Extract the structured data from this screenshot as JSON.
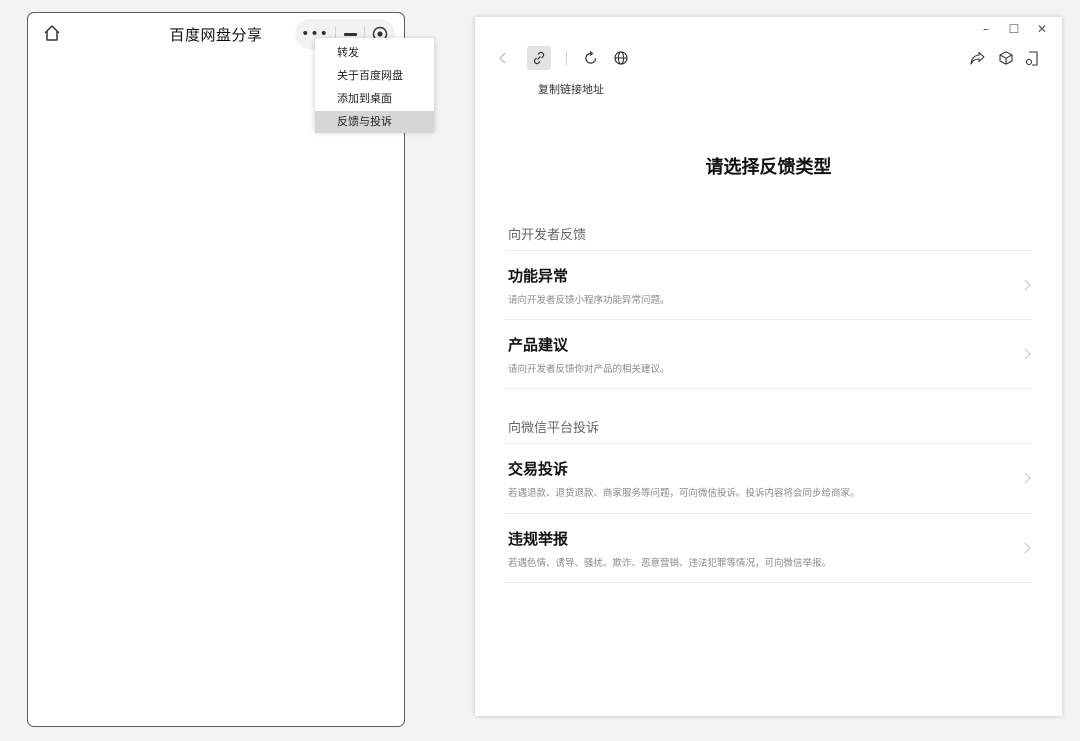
{
  "mini_program": {
    "title": "百度网盘分享",
    "capsule": {
      "more_label": "•••"
    },
    "menu": {
      "items": [
        {
          "label": "转发"
        },
        {
          "label": "关于百度网盘"
        },
        {
          "label": "添加到桌面"
        },
        {
          "label": "反馈与投诉",
          "active": true
        }
      ]
    },
    "icons": {
      "home": "home-icon",
      "more": "more-dots-icon",
      "minimize": "minimize-icon",
      "close": "record-circle-icon"
    }
  },
  "feedback_window": {
    "window_controls": {
      "minimize": "–",
      "maximize": "☐",
      "close": "✕"
    },
    "toolbar": {
      "icons": [
        "back-arrow-icon",
        "link-icon",
        "refresh-icon",
        "globe-icon",
        "share-icon",
        "cube-icon",
        "document-icon"
      ],
      "tooltip": "复制链接地址"
    },
    "page_title": "请选择反馈类型",
    "sections": [
      {
        "label": "向开发者反馈",
        "items": [
          {
            "title": "功能异常",
            "desc": "请向开发者反馈小程序功能异常问题。"
          },
          {
            "title": "产品建议",
            "desc": "请向开发者反馈你对产品的相关建议。"
          }
        ]
      },
      {
        "label": "向微信平台投诉",
        "items": [
          {
            "title": "交易投诉",
            "desc": "若遇退款、退货退款、商家服务等问题，可向微信投诉。投诉内容将会同步给商家。"
          },
          {
            "title": "违规举报",
            "desc": "若遇色情、诱导、骚扰、欺诈、恶意营销、违法犯罪等情况，可向微信举报。"
          }
        ]
      }
    ],
    "colors": {
      "menu_active_bg": "#d6d6d6",
      "link_button_bg": "#e3e3e3"
    }
  }
}
